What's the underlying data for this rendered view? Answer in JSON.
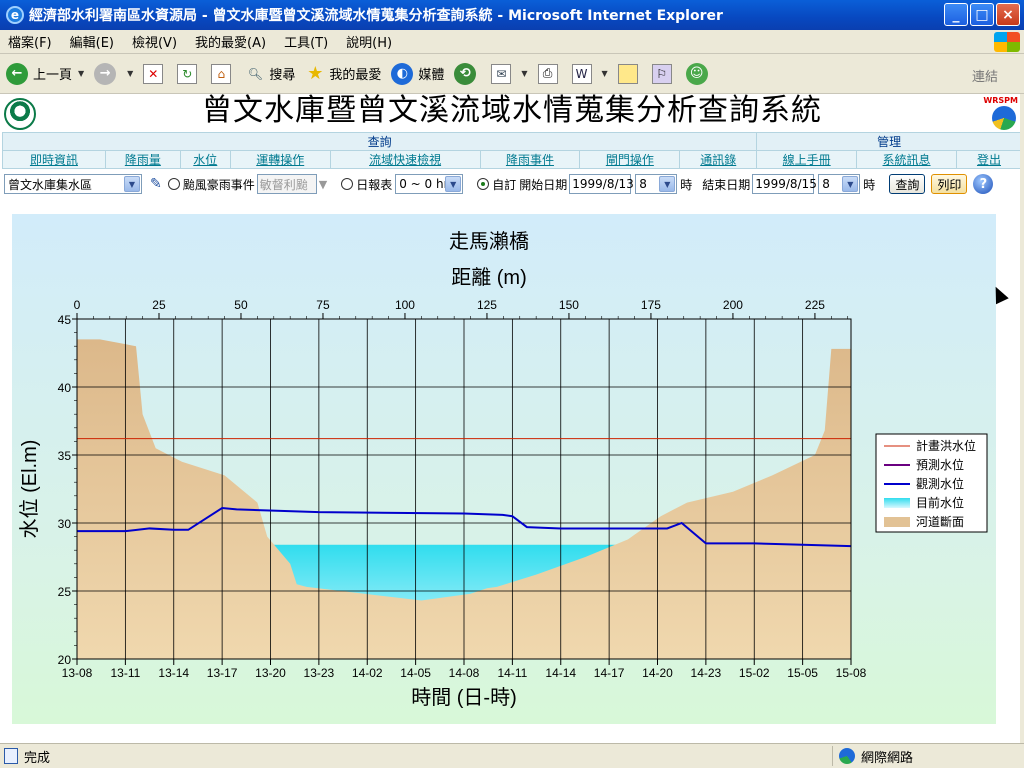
{
  "window": {
    "title": "經濟部水利署南區水資源局 - 曾文水庫暨曾文溪流域水情蒐集分析查詢系統 - Microsoft Internet Explorer"
  },
  "menubar": [
    "檔案(F)",
    "編輯(E)",
    "檢視(V)",
    "我的最愛(A)",
    "工具(T)",
    "說明(H)"
  ],
  "toolbar": {
    "back_label": "上一頁",
    "search_label": "搜尋",
    "favorites_label": "我的最愛",
    "media_label": "媒體",
    "links_label": "連結"
  },
  "header": {
    "title": "曾文水庫暨曾文溪流域水情蒐集分析查詢系統",
    "logo_text": "WRSPM"
  },
  "nav": {
    "group_query": "查詢",
    "group_admin": "管理",
    "items": [
      "即時資訊",
      "降雨量",
      "水位",
      "運轉操作",
      "流域快速檢視",
      "降雨事件",
      "閘門操作",
      "通訊錄",
      "線上手冊",
      "系統訊息",
      "登出"
    ]
  },
  "query": {
    "area_value": "曾文水庫集水區",
    "typhoon_label": "颱風豪雨事件",
    "typhoon_value": "敏督利颱",
    "daily_label": "日報表",
    "hour_range": "0 ~ 0 hr",
    "custom_label": "自訂",
    "start_label": "開始日期",
    "start_date": "1999/8/13",
    "start_hour": "8",
    "hour_unit": "時",
    "end_label": "結束日期",
    "end_date": "1999/8/15",
    "end_hour": "8",
    "query_button": "查詢",
    "print_button": "列印",
    "help_icon": "?"
  },
  "chart_data": {
    "type": "area",
    "title": "走馬瀨橋",
    "top_axis_label": "距離 (m)",
    "xlabel": "時間 (日-時)",
    "ylabel": "水位 (El.m)",
    "ylim": [
      20,
      45
    ],
    "y_ticks": [
      20,
      25,
      30,
      35,
      40,
      45
    ],
    "distance_lim": [
      0,
      236
    ],
    "distance_ticks": [
      0,
      25,
      50,
      75,
      100,
      125,
      150,
      175,
      200,
      225
    ],
    "time_ticks": [
      "13-08",
      "13-11",
      "13-14",
      "13-17",
      "13-20",
      "13-23",
      "14-02",
      "14-05",
      "14-08",
      "14-11",
      "14-14",
      "14-17",
      "14-20",
      "14-23",
      "15-02",
      "15-05",
      "15-08"
    ],
    "legend_position": "right",
    "legend": [
      "計畫洪水位",
      "預測水位",
      "觀測水位",
      "目前水位",
      "河道斷面"
    ],
    "colors": {
      "design_flood": "#cc2200",
      "predicted": "#6a0080",
      "observed": "#0000cc",
      "current": "#30ddee",
      "section": "#e2c295"
    },
    "design_flood_level": 36.2,
    "current_water_level": 28.4,
    "river_section": {
      "distance": [
        0,
        7,
        18,
        20,
        24,
        32,
        45,
        55,
        58,
        65,
        67,
        70,
        105,
        120,
        125,
        128,
        140,
        155,
        168,
        178,
        182,
        186,
        200,
        212,
        225,
        228,
        230,
        236
      ],
      "elevation": [
        43.5,
        43.5,
        43.0,
        38.0,
        35.5,
        34.5,
        33.5,
        31.5,
        29.0,
        27.0,
        25.5,
        25.3,
        24.3,
        24.8,
        25.2,
        25.3,
        26.2,
        27.5,
        28.8,
        30.5,
        31.0,
        31.5,
        32.3,
        33.5,
        35.0,
        36.8,
        42.8,
        42.8
      ]
    },
    "observed_series": {
      "time_index": [
        0,
        0.3,
        1,
        1.5,
        2,
        2.3,
        3,
        3.3,
        5,
        8,
        8.8,
        9,
        9.3,
        10,
        11,
        12,
        12.2,
        12.5,
        13,
        14,
        15,
        16
      ],
      "values": [
        29.4,
        29.4,
        29.4,
        29.6,
        29.5,
        29.5,
        31.1,
        31.0,
        30.8,
        30.7,
        30.6,
        30.5,
        29.7,
        29.6,
        29.6,
        29.6,
        29.6,
        30.0,
        28.5,
        28.5,
        28.4,
        28.3
      ]
    }
  },
  "status": {
    "left": "完成",
    "zone": "網際網路"
  }
}
